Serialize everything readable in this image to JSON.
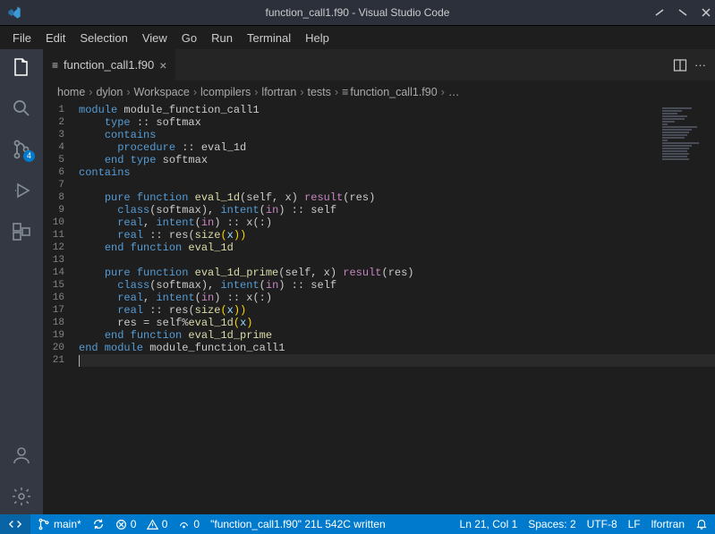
{
  "title": "function_call1.f90 - Visual Studio Code",
  "menu": [
    "File",
    "Edit",
    "Selection",
    "View",
    "Go",
    "Run",
    "Terminal",
    "Help"
  ],
  "activity_badge_scm": "4",
  "tab": {
    "label": "function_call1.f90",
    "close": "×"
  },
  "breadcrumb": [
    "home",
    "dylon",
    "Workspace",
    "lcompilers",
    "lfortran",
    "tests",
    "function_call1.f90",
    "…"
  ],
  "line_numbers": [
    "1",
    "2",
    "3",
    "4",
    "5",
    "6",
    "7",
    "8",
    "9",
    "10",
    "11",
    "12",
    "13",
    "14",
    "15",
    "16",
    "17",
    "18",
    "19",
    "20",
    "21"
  ],
  "code": {
    "l1": {
      "a": "module",
      "b": " module_function_call1"
    },
    "l2": {
      "a": "type",
      "b": " :: softmax"
    },
    "l3": {
      "a": "contains"
    },
    "l4": {
      "a": "procedure",
      "b": " :: eval_1d"
    },
    "l5": {
      "a": "end type",
      "b": " softmax"
    },
    "l6": {
      "a": "contains"
    },
    "l8": {
      "a": "pure function",
      "b": " eval_1d",
      "c": "(self, x) ",
      "d": "result",
      "e": "(res)"
    },
    "l9": {
      "a": "class",
      "b": "(softmax), ",
      "c": "intent",
      "d": "(",
      "e": "in",
      "f": ") :: self"
    },
    "l10": {
      "a": "real",
      "b": ", ",
      "c": "intent",
      "d": "(",
      "e": "in",
      "f": ") :: x(:)"
    },
    "l11": {
      "a": "real",
      "b": " :: res(",
      "c": "size",
      "d": "(",
      "e": "x",
      "f": "))"
    },
    "l12": {
      "a": "end function",
      "b": " eval_1d"
    },
    "l14": {
      "a": "pure function",
      "b": " eval_1d_prime",
      "c": "(self, x) ",
      "d": "result",
      "e": "(res)"
    },
    "l15": {
      "a": "class",
      "b": "(softmax), ",
      "c": "intent",
      "d": "(",
      "e": "in",
      "f": ") :: self"
    },
    "l16": {
      "a": "real",
      "b": ", ",
      "c": "intent",
      "d": "(",
      "e": "in",
      "f": ") :: x(:)"
    },
    "l17": {
      "a": "real",
      "b": " :: res(",
      "c": "size",
      "d": "(",
      "e": "x",
      "f": "))"
    },
    "l18": {
      "a": "res = self%",
      "b": "eval_1d",
      "c": "(",
      "d": "x",
      "e": ")"
    },
    "l19": {
      "a": "end function",
      "b": " eval_1d_prime"
    },
    "l20": {
      "a": "end module",
      "b": " module_function_call1"
    }
  },
  "status": {
    "branch": "main*",
    "sync": "",
    "errors": "0",
    "warnings": "0",
    "ports_icon_count": "0",
    "message": "\"function_call1.f90\" 21L 542C written",
    "position": "Ln 21, Col 1",
    "spaces": "Spaces: 2",
    "encoding": "UTF-8",
    "eol": "LF",
    "language": "lfortran"
  }
}
